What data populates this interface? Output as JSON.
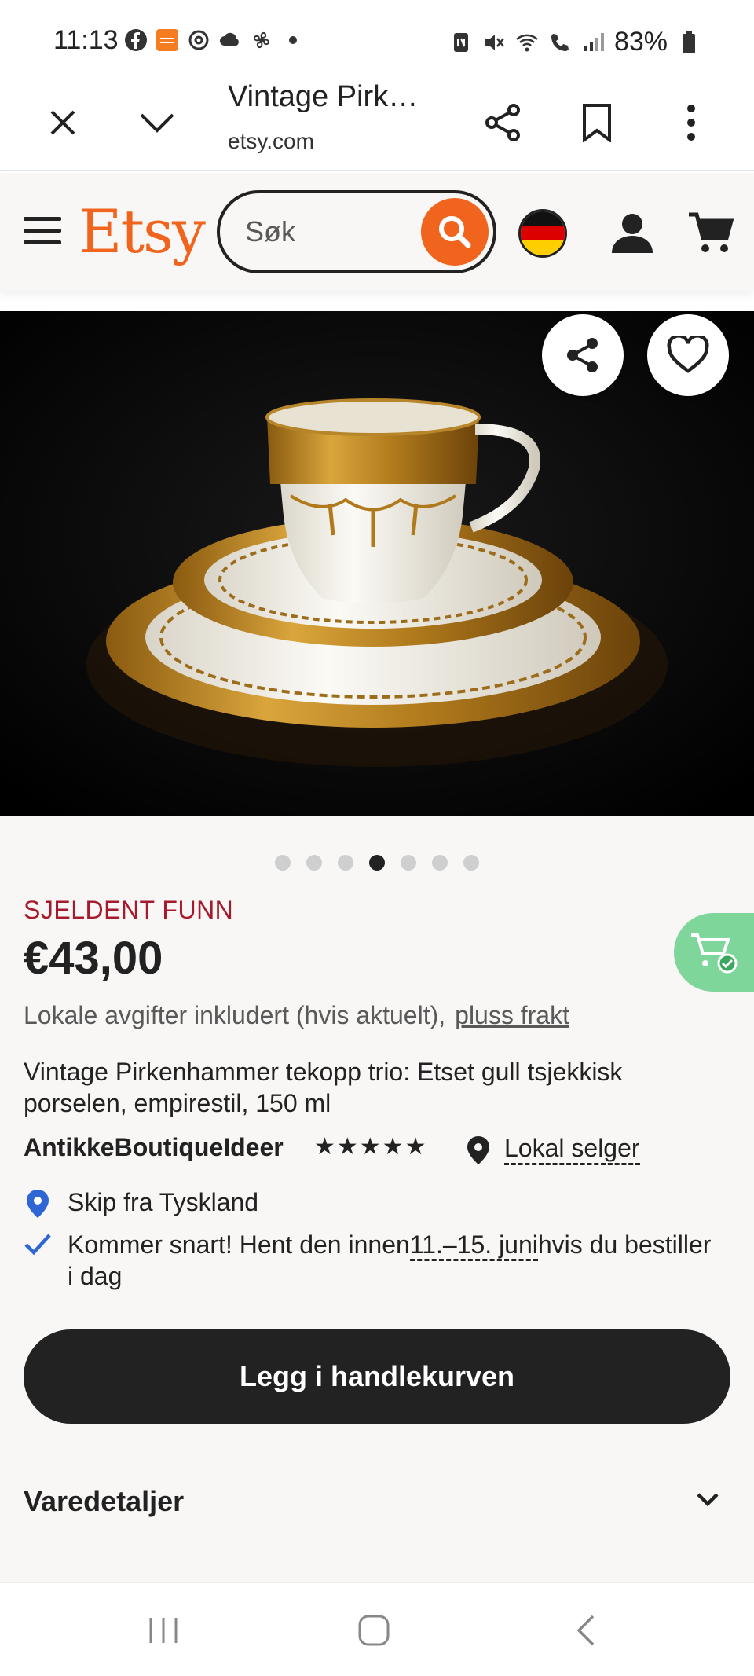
{
  "status_bar": {
    "time": "11:13",
    "battery": "83%",
    "left_icons": [
      "facebook-icon",
      "temu-icon",
      "threads-icon",
      "cloud-icon",
      "fan-icon",
      "dot-icon"
    ],
    "right_icons": [
      "nfc-icon",
      "mute-icon",
      "wifi-icon",
      "wifi-call-icon",
      "signal-icon",
      "battery-icon"
    ]
  },
  "browser": {
    "title": "Vintage Pirk…",
    "url": "etsy.com"
  },
  "header": {
    "logo": "Etsy",
    "search_placeholder": "Søk",
    "brand_color": "#f1641e"
  },
  "gallery": {
    "image_alt": "Gold-rimmed porcelain teacup trio",
    "dot_count": 7,
    "active_dot": 4
  },
  "product": {
    "badge": "SJELDENT FUNN",
    "price": "€43,00",
    "fees_text": "Lokale avgifter inkludert (hvis aktuelt),",
    "shipping_link": "pluss frakt",
    "title": "Vintage Pirkenhammer tekopp trio: Etset gull tsjekkisk porselen, empirestil, 150 ml",
    "seller": "AntikkeBoutiqueIdeer",
    "stars": "★★★★★",
    "rating_value": 5,
    "local_seller": "Lokal selger",
    "ships_from": "Skip fra Tyskland",
    "delivery_pre": "Kommer snart! Hent den innen",
    "delivery_date": "11.–15. juni",
    "delivery_post": "hvis du bestiller i dag",
    "add_to_cart": "Legg i handlekurven",
    "details_label": "Varedetaljer"
  }
}
